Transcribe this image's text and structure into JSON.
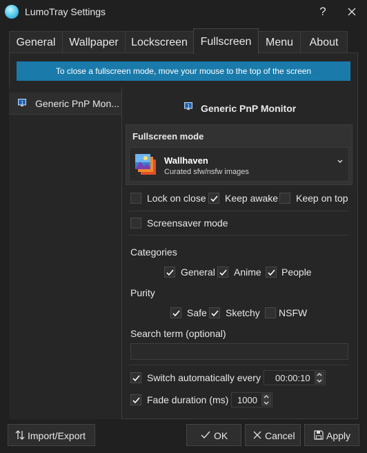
{
  "window": {
    "title": "LumoTray Settings",
    "help_label": "?"
  },
  "tabs": [
    {
      "label": "General"
    },
    {
      "label": "Wallpaper"
    },
    {
      "label": "Lockscreen"
    },
    {
      "label": "Fullscreen",
      "active": true
    },
    {
      "label": "Menu"
    },
    {
      "label": "About"
    }
  ],
  "banner": {
    "text": "To close a fullscreen mode, move your mouse to the top of the screen"
  },
  "monitors": {
    "list_item_label": "Generic PnP Mon...",
    "selected_heading": "Generic PnP Monitor"
  },
  "fullscreen_mode": {
    "section_label": "Fullscreen mode",
    "selected_title": "Wallhaven",
    "selected_subtitle": "Curated sfw/nsfw images",
    "icon": "wallhaven-icon"
  },
  "options": {
    "lock_on_close": {
      "label": "Lock on close",
      "checked": false
    },
    "keep_awake": {
      "label": "Keep awake",
      "checked": true
    },
    "keep_on_top": {
      "label": "Keep on top",
      "checked": false
    },
    "screensaver_mode": {
      "label": "Screensaver mode",
      "checked": false
    }
  },
  "categories": {
    "label": "Categories",
    "general": {
      "label": "General",
      "checked": true
    },
    "anime": {
      "label": "Anime",
      "checked": true
    },
    "people": {
      "label": "People",
      "checked": true
    }
  },
  "purity": {
    "label": "Purity",
    "safe": {
      "label": "Safe",
      "checked": true
    },
    "sketchy": {
      "label": "Sketchy",
      "checked": true
    },
    "nsfw": {
      "label": "NSFW",
      "checked": false
    }
  },
  "search": {
    "label": "Search term (optional)",
    "value": "",
    "placeholder": ""
  },
  "switch_auto": {
    "label": "Switch automatically every",
    "checked": true,
    "value": "00:00:10"
  },
  "fade": {
    "label": "Fade duration (ms)",
    "checked": true,
    "value": "1000"
  },
  "footer": {
    "import_export_label": "Import/Export",
    "ok_label": "OK",
    "cancel_label": "Cancel",
    "apply_label": "Apply"
  },
  "colors": {
    "accent": "#1a7bab",
    "background": "#202020",
    "panel": "#262626"
  }
}
